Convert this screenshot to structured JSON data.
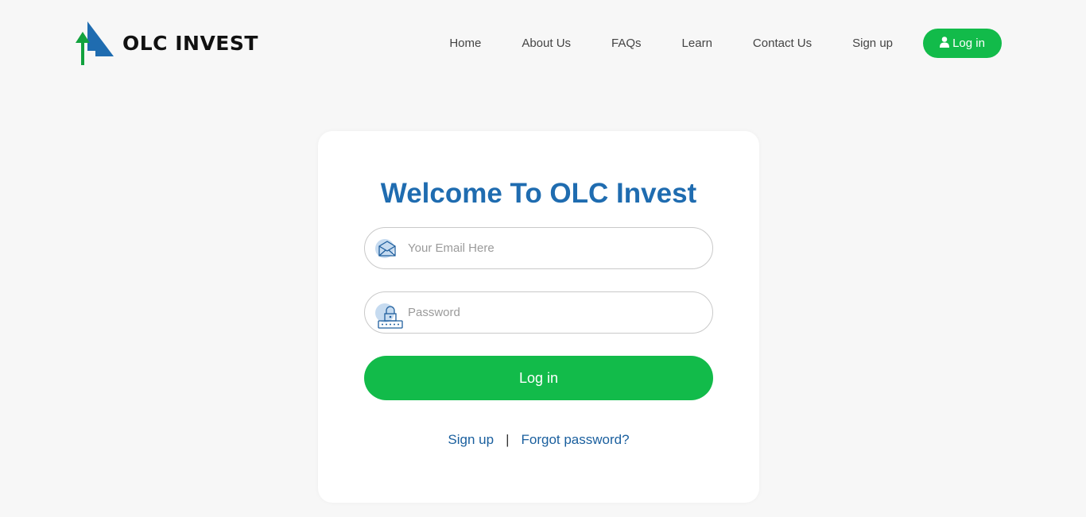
{
  "brand": {
    "name": "OLC INVEST",
    "logo_icon": "arrow-triangle-logo",
    "accent_green": "#12bb4a",
    "accent_blue": "#1f6cb0"
  },
  "nav": {
    "items": [
      "Home",
      "About Us",
      "FAQs",
      "Learn",
      "Contact Us",
      "Sign up"
    ],
    "login_label": "Log in",
    "login_icon": "user-icon"
  },
  "login_card": {
    "title": "Welcome To OLC Invest",
    "email_placeholder": "Your Email Here",
    "email_icon": "envelope-icon",
    "password_placeholder": "Password",
    "password_icon": "lock-icon",
    "submit_label": "Log in",
    "signup_link": "Sign up",
    "separator": "|",
    "forgot_link": "Forgot password?"
  }
}
